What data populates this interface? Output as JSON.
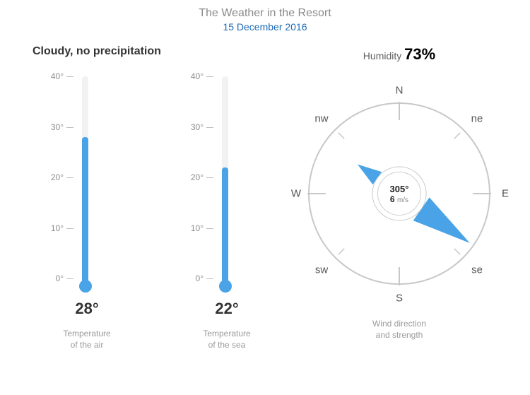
{
  "header": {
    "title": "The Weather in the Resort",
    "date": "15 December 2016"
  },
  "conditions": "Cloudy, no precipitation",
  "humidity": {
    "label": "Humidity",
    "value": "73%"
  },
  "thermometer_axis": {
    "min": 0,
    "max": 40,
    "ticks": [
      0,
      10,
      20,
      30,
      40
    ],
    "tick_labels": [
      "0°",
      "10°",
      "20°",
      "30°",
      "40°"
    ]
  },
  "thermometers": {
    "air": {
      "value": 28,
      "value_label": "28°",
      "caption1": "Temperature",
      "caption2": "of the air"
    },
    "sea": {
      "value": 22,
      "value_label": "22°",
      "caption1": "Temperature",
      "caption2": "of the sea"
    }
  },
  "compass": {
    "labels": {
      "n": "N",
      "ne": "ne",
      "e": "E",
      "se": "se",
      "s": "S",
      "sw": "sw",
      "w": "W",
      "nw": "nw"
    },
    "direction_deg": 305,
    "direction_label": "305°",
    "speed_value": "6",
    "speed_unit": "m/s",
    "caption1": "Wind direction",
    "caption2": "and strength"
  },
  "colors": {
    "accent": "#4aa3e6",
    "muted": "#bfbfbf"
  },
  "chart_data": [
    {
      "type": "bar",
      "title": "Temperature of the air",
      "categories": [
        "Air"
      ],
      "values": [
        28
      ],
      "ylabel": "°",
      "ylim": [
        0,
        40
      ]
    },
    {
      "type": "bar",
      "title": "Temperature of the sea",
      "categories": [
        "Sea"
      ],
      "values": [
        22
      ],
      "ylabel": "°",
      "ylim": [
        0,
        40
      ]
    },
    {
      "type": "gauge",
      "title": "Wind direction and strength",
      "series": [
        {
          "name": "direction_deg",
          "values": [
            305
          ]
        },
        {
          "name": "speed_m_s",
          "values": [
            6
          ]
        }
      ]
    },
    {
      "type": "gauge",
      "title": "Humidity",
      "categories": [
        "Humidity %"
      ],
      "values": [
        73
      ],
      "ylim": [
        0,
        100
      ]
    }
  ]
}
